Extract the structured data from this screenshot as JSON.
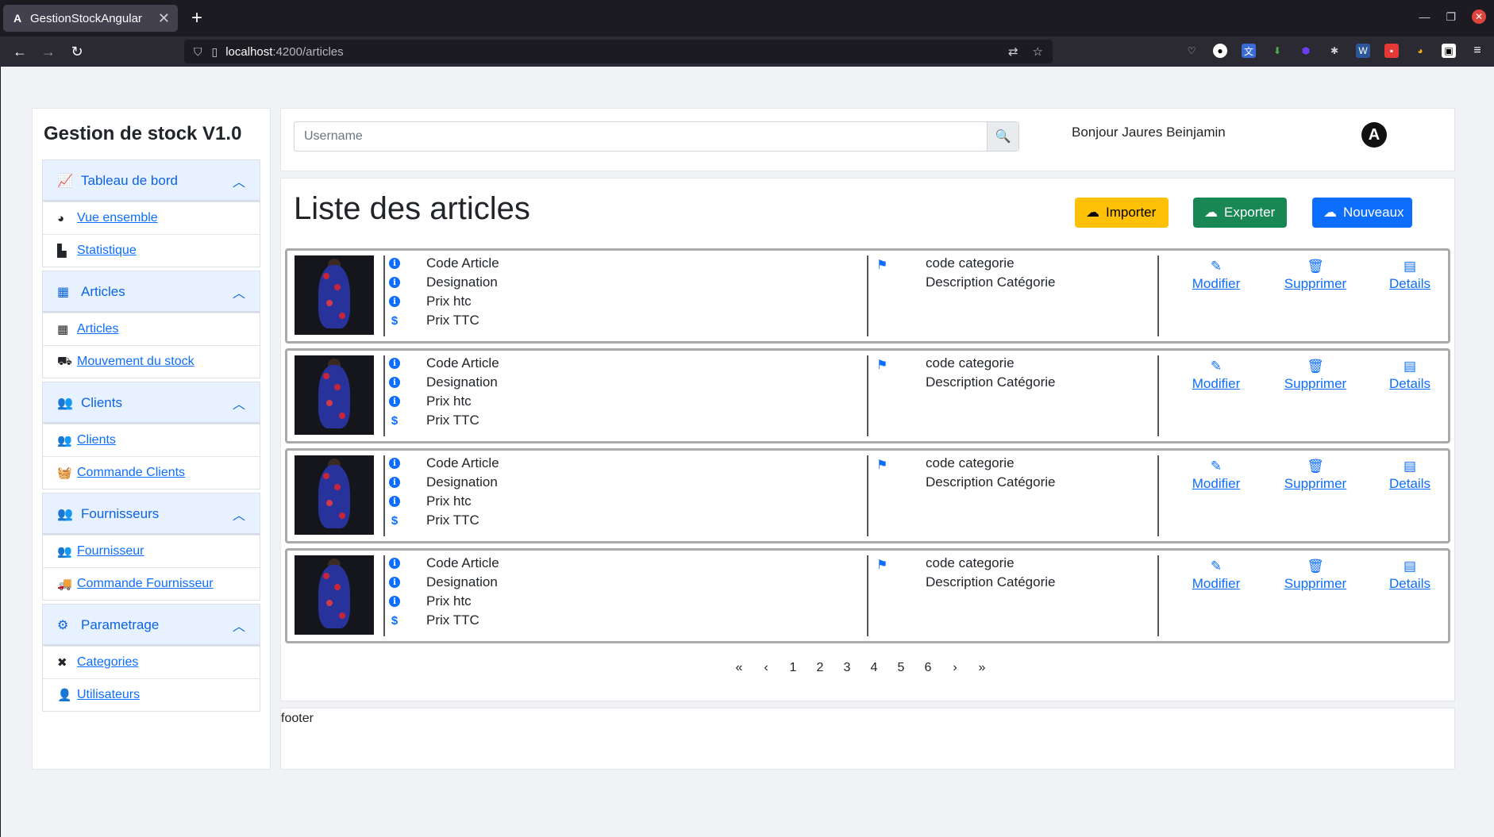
{
  "browser": {
    "tab_title": "GestionStockAngular",
    "tab_favicon": "A",
    "url_host": "localhost",
    "url_path": ":4200/articles"
  },
  "sidebar": {
    "brand": "Gestion de stock V1.0",
    "sections": [
      {
        "title": "Tableau de bord",
        "icon": "chart-line-icon",
        "items": [
          {
            "label": "Vue ensemble",
            "icon": "pie-chart-icon"
          },
          {
            "label": "Statistique",
            "icon": "bar-chart-icon"
          }
        ]
      },
      {
        "title": "Articles",
        "icon": "boxes-icon",
        "items": [
          {
            "label": "Articles",
            "icon": "boxes-icon"
          },
          {
            "label": "Mouvement du stock",
            "icon": "dolly-icon"
          }
        ]
      },
      {
        "title": "Clients",
        "icon": "users-icon",
        "items": [
          {
            "label": "Clients",
            "icon": "users-icon"
          },
          {
            "label": "Commande Clients",
            "icon": "basket-icon"
          }
        ]
      },
      {
        "title": "Fournisseurs",
        "icon": "users-icon",
        "items": [
          {
            "label": "Fournisseur",
            "icon": "users-icon"
          },
          {
            "label": "Commande Fournisseur",
            "icon": "truck-icon"
          }
        ]
      },
      {
        "title": "Parametrage",
        "icon": "cogs-icon",
        "items": [
          {
            "label": "Categories",
            "icon": "tools-icon"
          },
          {
            "label": "Utilisateurs",
            "icon": "user-cog-icon"
          }
        ]
      }
    ]
  },
  "topbar": {
    "search_placeholder": "Username",
    "greeting": "Bonjour Jaures Beinjamin",
    "logo_letter": "A"
  },
  "page": {
    "title": "Liste des articles",
    "buttons": {
      "import": "Importer",
      "export": "Exporter",
      "new": "Nouveaux"
    }
  },
  "article_card": {
    "fields": [
      "Code Article",
      "Designation",
      "Prix htc",
      "Prix TTC"
    ],
    "category_fields": [
      "code categorie",
      "Description Catégorie"
    ],
    "actions": {
      "edit": "Modifier",
      "delete": "Supprimer",
      "details": "Details"
    }
  },
  "cards_count": 4,
  "pagination": {
    "first": "«",
    "prev": "‹",
    "pages": [
      "1",
      "2",
      "3",
      "4",
      "5",
      "6"
    ],
    "next": "›",
    "last": "»"
  },
  "footer": {
    "text": "footer"
  },
  "colors": {
    "primary": "#0d6efd",
    "warning": "#ffc107",
    "success": "#198754",
    "accordion_bg": "#e7f1ff"
  }
}
